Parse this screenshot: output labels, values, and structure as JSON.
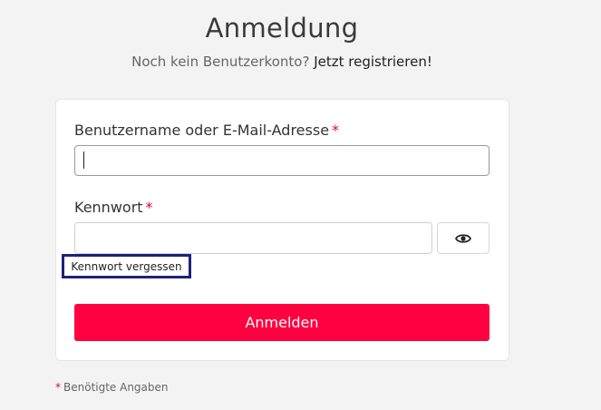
{
  "header": {
    "title": "Anmeldung",
    "subtitle_text": "Noch kein Benutzerkonto?",
    "register_link": "Jetzt registrieren!"
  },
  "form": {
    "username_label": "Benutzername oder E-Mail-Adresse",
    "username_value": "",
    "password_label": "Kennwort",
    "password_value": "",
    "required_marker": "*",
    "toggle_password_icon": "eye-icon",
    "forgot_link": "Kennwort vergessen",
    "submit_label": "Anmelden"
  },
  "footer": {
    "required_marker": "*",
    "required_note": "Benötigte Angaben"
  },
  "colors": {
    "accent": "#ff0040",
    "required": "#e8003d",
    "focus_outline": "#1a237e",
    "background": "#f3f3f3"
  }
}
